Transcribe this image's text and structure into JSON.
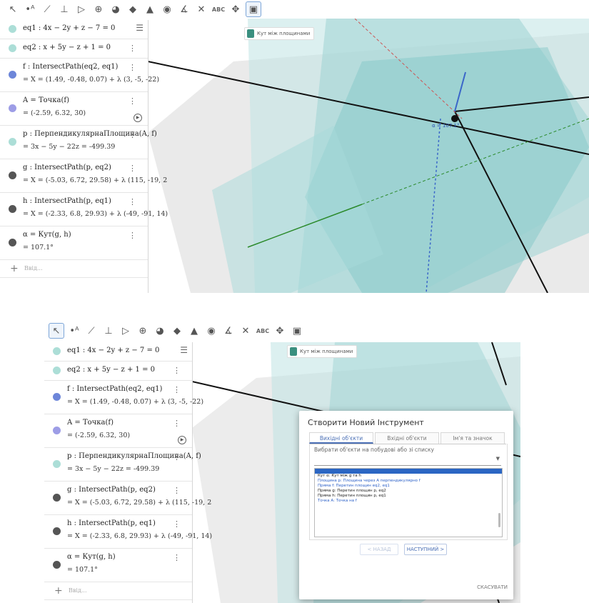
{
  "toolbar": {
    "tools": [
      "cursor-arrow-icon",
      "point-icon",
      "line-icon",
      "perpendicular-icon",
      "polygon-icon",
      "circle-icon",
      "sphere-icon",
      "plane-icon",
      "pyramid-icon",
      "sphere-dot-icon",
      "angle-icon",
      "reflect-icon",
      "text-icon",
      "move-view-icon",
      "custom-tool-icon"
    ],
    "text_tool_label": "ABC"
  },
  "algebra": {
    "rows": [
      {
        "color": "#67c2b6",
        "definition": "eq1 : 4x − 2y + z − 7 = 0",
        "value": ""
      },
      {
        "color": "#67c2b6",
        "definition": "eq2 : x + 5y − z + 1 = 0",
        "value": ""
      },
      {
        "color": "#6d86d9",
        "definition": "f : IntersectPath(eq2, eq1)",
        "value": "= X = (1.49, -0.48, 0.07) + λ (3, -5, -22)"
      },
      {
        "color": "#9d9de6",
        "definition": "A = Точка(f)",
        "value": "= (-2.59, 6.32, 30)"
      },
      {
        "color": "#67c2b6",
        "definition": "p : ПерпендикулярнаПлощина(A, f)",
        "value": "= 3x − 5y − 22z = -499.39"
      },
      {
        "color": "#555555",
        "definition": "g : IntersectPath(p, eq2)",
        "value": "= X = (-5.03, 6.72, 29.58) + λ (115, -19, 2"
      },
      {
        "color": "#555555",
        "definition": "h : IntersectPath(p, eq1)",
        "value": "= X = (-2.33, 6.8, 29.93) + λ (-49, -91, 14)"
      },
      {
        "color": "#555555",
        "definition": "α = Кут(g, h)",
        "value": "= 107.1°"
      }
    ],
    "input_placeholder": "Ввід..."
  },
  "graphics": {
    "tooltip_text": "Кут між площинами",
    "angle_label": "α = 107.1°"
  },
  "dialog": {
    "title": "Створити Новий Інструмент",
    "tabs": [
      "Вихідні об'єкти",
      "Вхідні об'єкти",
      "Ім'я та значок"
    ],
    "hint": "Вибрати об'єкти на побудові або зі списку",
    "list_items": [
      {
        "text": "Кут α: Кут між g та h",
        "blue": false
      },
      {
        "text": "Площина p: Площина через A перпендикулярно f",
        "blue": true
      },
      {
        "text": "Пряма f: Перетин площин eq2, eq1",
        "blue": true
      },
      {
        "text": "Пряма g: Перетин площин p, eq2",
        "blue": false
      },
      {
        "text": "Пряма h: Перетин площин p, eq1",
        "blue": false
      },
      {
        "text": "Точка A: Точка на f",
        "blue": true
      }
    ],
    "back_label": "< НАЗАД",
    "next_label": "НАСТУПНИЙ >",
    "cancel_label": "СКАСУВАТИ"
  }
}
